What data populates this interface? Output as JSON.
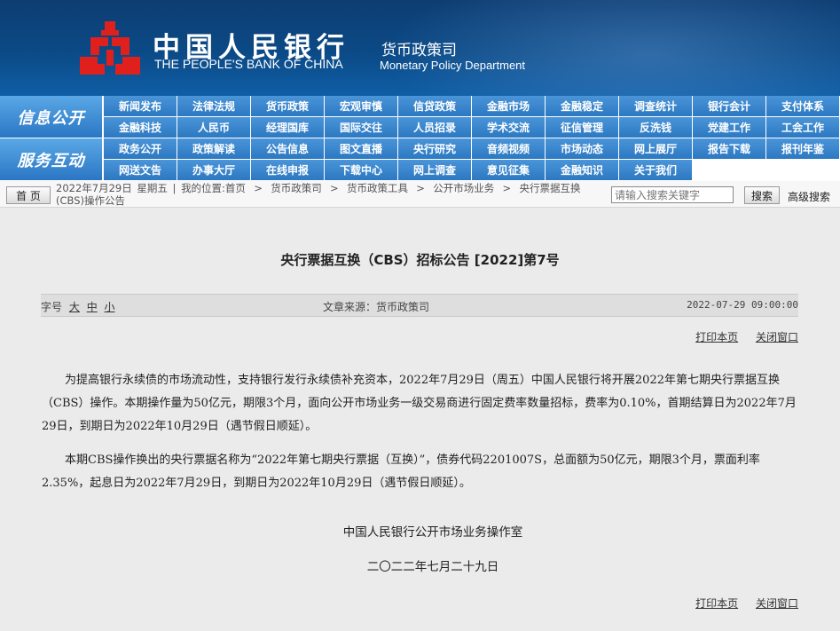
{
  "header": {
    "bank_cn": "中国人民银行",
    "bank_en": "THE PEOPLE'S BANK OF CHINA",
    "dept_cn": "货币政策司",
    "dept_en": "Monetary Policy Department"
  },
  "nav": {
    "section1_label": "信息公开",
    "section2_label": "服务互动",
    "section1_items": [
      "新闻发布",
      "法律法规",
      "货币政策",
      "宏观审慎",
      "信贷政策",
      "金融市场",
      "金融稳定",
      "调查统计",
      "银行会计",
      "支付体系",
      "金融科技",
      "人民币",
      "经理国库",
      "国际交往",
      "人员招录",
      "学术交流",
      "征信管理",
      "反洗钱",
      "党建工作",
      "工会工作"
    ],
    "section2_items": [
      "政务公开",
      "政策解读",
      "公告信息",
      "图文直播",
      "央行研究",
      "音频视频",
      "市场动态",
      "网上展厅",
      "报告下载",
      "报刊年鉴",
      "网送文告",
      "办事大厅",
      "在线申报",
      "下载中心",
      "网上调查",
      "意见征集",
      "金融知识",
      "关于我们"
    ]
  },
  "breadcrumb": {
    "home_label": "首 页",
    "date": "2022年7月29日",
    "weekday": "星期五",
    "location_prefix": "我的位置:首页",
    "levels": [
      "货币政策司",
      "货币政策工具",
      "公开市场业务",
      "央行票据互换(CBS)操作公告"
    ]
  },
  "search": {
    "placeholder": "请输入搜索关键字",
    "button_label": "搜索",
    "advanced_label": "高级搜索"
  },
  "article": {
    "title": "央行票据互换（CBS）招标公告 [2022]第7号",
    "font_label": "字号",
    "font_large": "大",
    "font_medium": "中",
    "font_small": "小",
    "source": "文章来源：货币政策司",
    "datetime": "2022-07-29 09:00:00",
    "print_label": "打印本页",
    "close_label": "关闭窗口",
    "paragraph1": "为提高银行永续债的市场流动性，支持银行发行永续债补充资本，2022年7月29日（周五）中国人民银行将开展2022年第七期央行票据互换（CBS）操作。本期操作量为50亿元，期限3个月，面向公开市场业务一级交易商进行固定费率数量招标，费率为0.10%，首期结算日为2022年7月29日，到期日为2022年10月29日（遇节假日顺延）。",
    "paragraph2": "本期CBS操作换出的央行票据名称为“2022年第七期央行票据（互换）”，债券代码2201007S，总面额为50亿元，期限3个月，票面利率2.35%，起息日为2022年7月29日，到期日为2022年10月29日（遇节假日顺延）。",
    "signature_org": "中国人民银行公开市场业务操作室",
    "signature_date": "二〇二二年七月二十九日"
  }
}
